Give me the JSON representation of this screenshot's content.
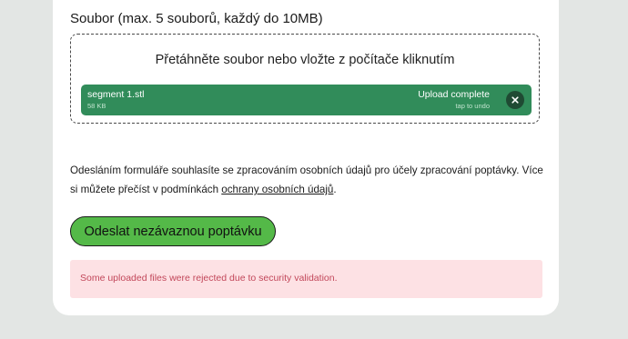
{
  "upload": {
    "label": "Soubor (max. 5 souborů, každý do 10MB)",
    "drop_hint": "Přetáhněte soubor nebo vložte z počítače kliknutím",
    "file": {
      "name": "segment 1.stl",
      "size": "58 KB",
      "status": "Upload complete",
      "undo_hint": "tap to undo",
      "remove_icon": "close-icon",
      "color": "#318c5a"
    }
  },
  "consent": {
    "text": "Odesláním formuláře souhlasíte se zpracováním osobních údajů pro účely zpracování poptávky. Více si můžete přečíst v podmínkách ",
    "link_text": "ochrany osobních údajů",
    "suffix": "."
  },
  "submit": {
    "label": "Odeslat nezávaznou poptávku",
    "color": "#54b948"
  },
  "alert": {
    "message": "Some uploaded files were rejected due to security validation.",
    "color": "#c2475a",
    "background": "#fde1e4"
  }
}
